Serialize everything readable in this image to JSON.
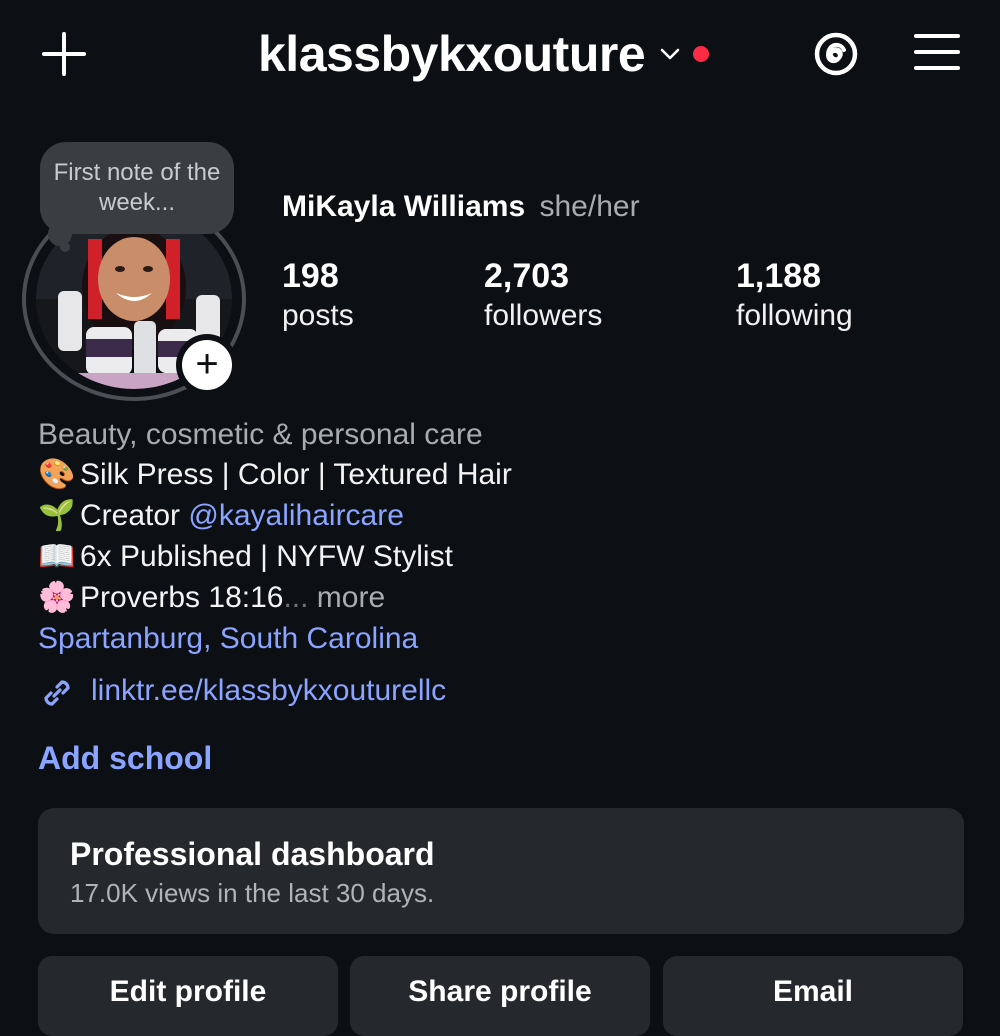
{
  "header": {
    "username": "klassbykxouture",
    "icons": [
      "plus-icon",
      "chevron-down-icon",
      "threads-icon",
      "menu-icon"
    ],
    "accent_dot_color": "#ff2a44"
  },
  "note": {
    "text": "First note of the week..."
  },
  "profile": {
    "display_name": "MiKayla Williams",
    "pronouns": "she/her",
    "stats": [
      {
        "value": "198",
        "label": "posts"
      },
      {
        "value": "2,703",
        "label": "followers"
      },
      {
        "value": "1,188",
        "label": "following"
      }
    ]
  },
  "bio": {
    "category": "Beauty, cosmetic & personal care",
    "lines": [
      {
        "emoji": "🎨",
        "text": "Silk Press | Color | Textured Hair"
      },
      {
        "emoji": "🌱",
        "text": "Creator ",
        "mention": "@kayalihaircare"
      },
      {
        "emoji": "📖",
        "text": "6x Published | NYFW Stylist"
      },
      {
        "emoji": "🌸",
        "text": "Proverbs 18:16",
        "ellipsis": "...",
        "more": " more"
      }
    ],
    "location": "Spartanburg, South Carolina",
    "website": "linktr.ee/klassbykxouturellc",
    "add_school": "Add school",
    "link_color": "#8aa4ff"
  },
  "dashboard": {
    "title": "Professional dashboard",
    "subtitle": "17.0K views in the last 30 days."
  },
  "actions": [
    "Edit profile",
    "Share profile",
    "Email"
  ]
}
